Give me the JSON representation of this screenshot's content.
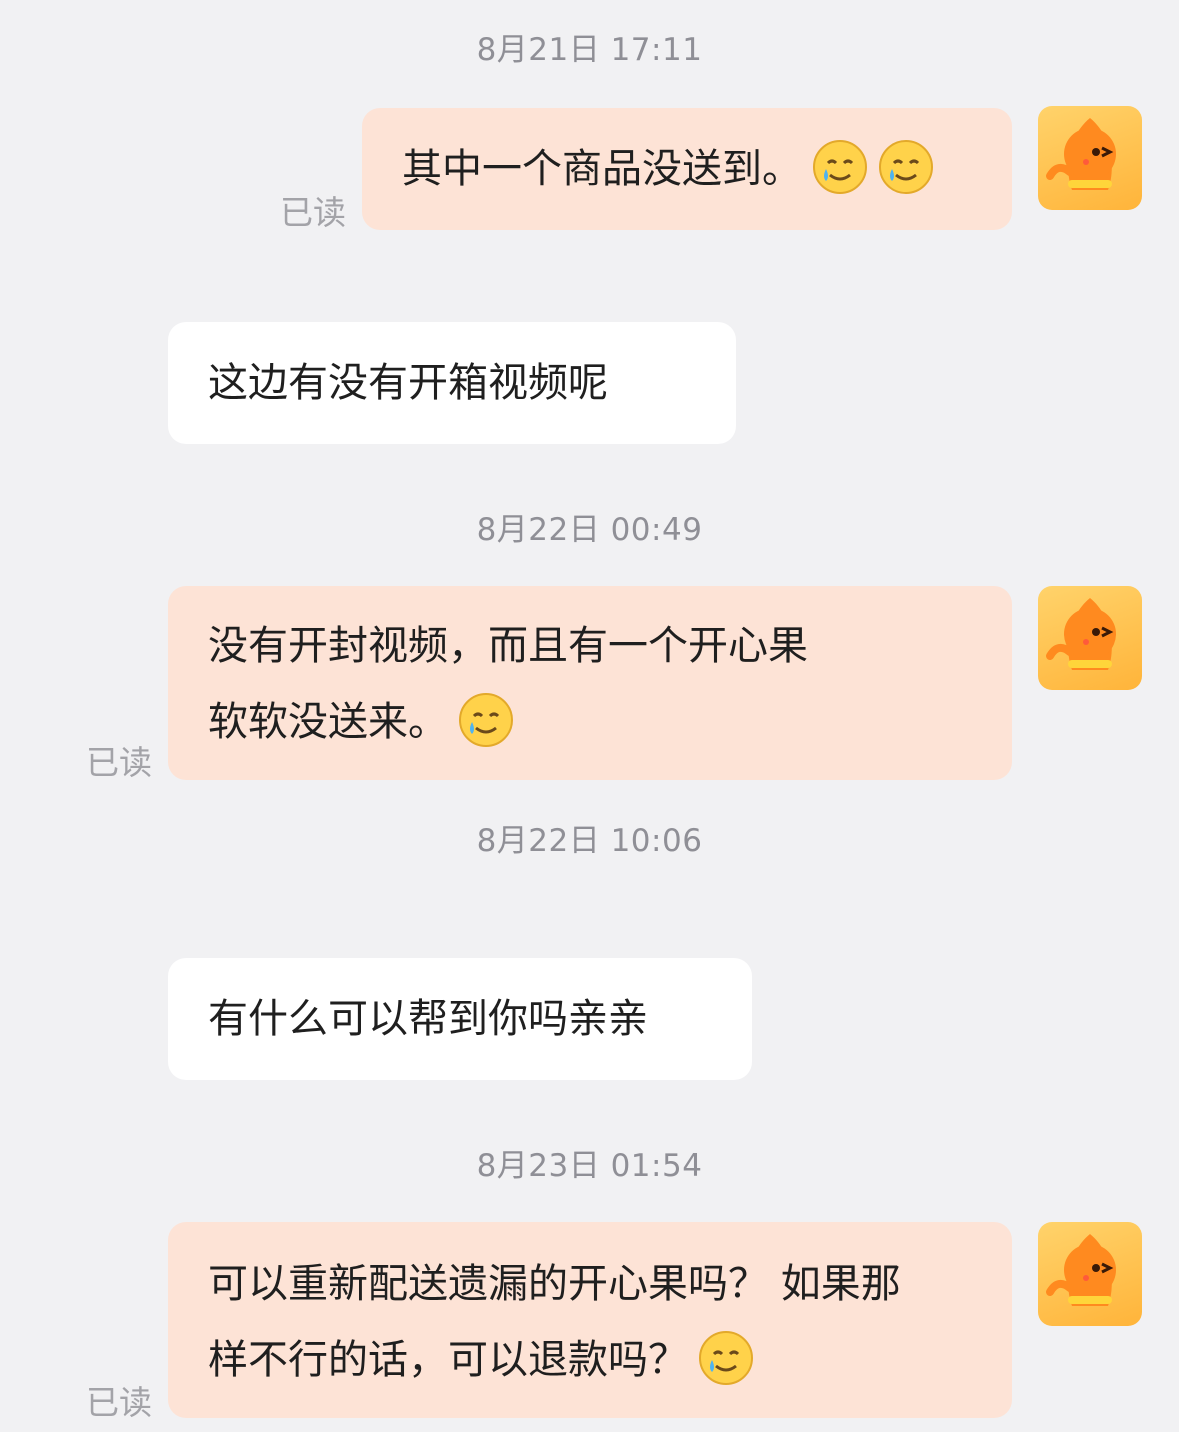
{
  "messages": [
    {
      "type": "timestamp",
      "text": "8月21日 17:11"
    },
    {
      "type": "outgoing",
      "text": "其中一个商品没送到。",
      "emojis": [
        "crying-smile-emoji",
        "crying-smile-emoji"
      ],
      "read": "已读"
    },
    {
      "type": "incoming",
      "text": "这边有没有开箱视频呢"
    },
    {
      "type": "timestamp",
      "text": "8月22日 00:49"
    },
    {
      "type": "outgoing",
      "lines": [
        "没有开封视频，而且有一个开心果",
        "软软没送来。"
      ],
      "emojis": [
        "crying-smile-emoji"
      ],
      "read": "已读"
    },
    {
      "type": "timestamp",
      "text": "8月22日 10:06"
    },
    {
      "type": "incoming",
      "text": "有什么可以帮到你吗亲亲"
    },
    {
      "type": "timestamp",
      "text": "8月23日 01:54"
    },
    {
      "type": "outgoing",
      "lines": [
        "可以重新配送遗漏的开心果吗？ 如果那",
        "样不行的话，可以退款吗？"
      ],
      "emojis": [
        "crying-smile-emoji"
      ],
      "read": "已读"
    }
  ],
  "colors": {
    "background": "#f1f1f3",
    "outgoing_bubble": "#fde3d6",
    "incoming_bubble": "#ffffff",
    "avatar": "#ffb43a"
  }
}
